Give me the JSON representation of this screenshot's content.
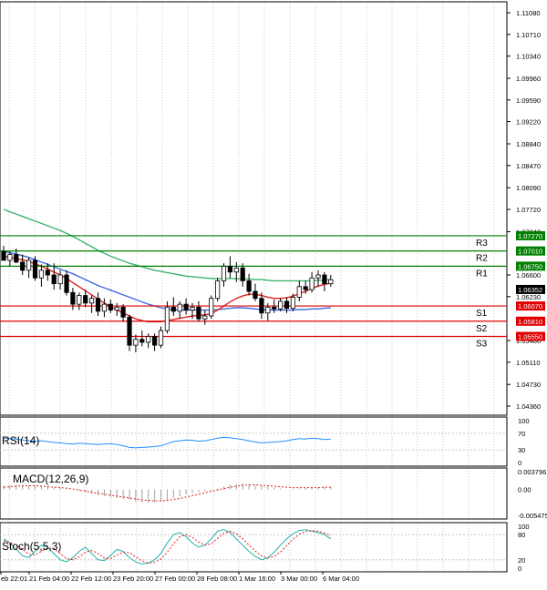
{
  "chart_data": {
    "type": "candlestick",
    "time_labels": [
      "eb 22:01",
      "21 Feb 04:00",
      "22 Feb 12:00",
      "23 Feb 20:00",
      "27 Feb 00:00",
      "28 Feb 08:00",
      "1 Mar 16:00",
      "3 Mar 00:00",
      "6 Mar 04:00"
    ],
    "price_ticks": [
      "1.11080",
      "1.10710",
      "1.10340",
      "1.09960",
      "1.09590",
      "1.09220",
      "1.08840",
      "1.08470",
      "1.08090",
      "1.07720",
      "1.07340",
      "1.06600",
      "1.06230",
      "1.05480",
      "1.05110",
      "1.04730",
      "1.04360"
    ],
    "current_price": "1.06352",
    "levels": [
      {
        "name": "R3",
        "value": "1.07270",
        "color": "#008000"
      },
      {
        "name": "R2",
        "value": "1.07010",
        "color": "#008000"
      },
      {
        "name": "R1",
        "value": "1.06750",
        "color": "#008000"
      },
      {
        "name": "S1",
        "value": "1.06070",
        "color": "#e00000"
      },
      {
        "name": "S2",
        "value": "1.05810",
        "color": "#e00000"
      },
      {
        "name": "S3",
        "value": "1.05550",
        "color": "#e00000"
      }
    ],
    "candles": [
      {
        "o": 1.07,
        "h": 1.071,
        "l": 1.069,
        "c": 1.0685
      },
      {
        "o": 1.0685,
        "h": 1.07,
        "l": 1.0675,
        "c": 1.0695
      },
      {
        "o": 1.0695,
        "h": 1.0705,
        "l": 1.068,
        "c": 1.0682
      },
      {
        "o": 1.0682,
        "h": 1.0695,
        "l": 1.066,
        "c": 1.0668
      },
      {
        "o": 1.0668,
        "h": 1.069,
        "l": 1.0655,
        "c": 1.0685
      },
      {
        "o": 1.0685,
        "h": 1.0692,
        "l": 1.065,
        "c": 1.0655
      },
      {
        "o": 1.0655,
        "h": 1.0678,
        "l": 1.064,
        "c": 1.0668
      },
      {
        "o": 1.0668,
        "h": 1.068,
        "l": 1.065,
        "c": 1.066
      },
      {
        "o": 1.066,
        "h": 1.068,
        "l": 1.0635,
        "c": 1.0645
      },
      {
        "o": 1.0645,
        "h": 1.0668,
        "l": 1.0635,
        "c": 1.066
      },
      {
        "o": 1.066,
        "h": 1.0668,
        "l": 1.0625,
        "c": 1.063
      },
      {
        "o": 1.063,
        "h": 1.0638,
        "l": 1.06,
        "c": 1.061
      },
      {
        "o": 1.061,
        "h": 1.063,
        "l": 1.06,
        "c": 1.0625
      },
      {
        "o": 1.0625,
        "h": 1.0635,
        "l": 1.0605,
        "c": 1.0612
      },
      {
        "o": 1.0612,
        "h": 1.0625,
        "l": 1.0595,
        "c": 1.062
      },
      {
        "o": 1.062,
        "h": 1.063,
        "l": 1.059,
        "c": 1.0598
      },
      {
        "o": 1.0598,
        "h": 1.062,
        "l": 1.0588,
        "c": 1.061
      },
      {
        "o": 1.061,
        "h": 1.0618,
        "l": 1.0595,
        "c": 1.06
      },
      {
        "o": 1.06,
        "h": 1.0612,
        "l": 1.059,
        "c": 1.0605
      },
      {
        "o": 1.0605,
        "h": 1.061,
        "l": 1.058,
        "c": 1.0588
      },
      {
        "o": 1.0588,
        "h": 1.0592,
        "l": 1.053,
        "c": 1.054
      },
      {
        "o": 1.054,
        "h": 1.0558,
        "l": 1.0528,
        "c": 1.055
      },
      {
        "o": 1.055,
        "h": 1.0565,
        "l": 1.0538,
        "c": 1.0545
      },
      {
        "o": 1.0545,
        "h": 1.056,
        "l": 1.0535,
        "c": 1.0555
      },
      {
        "o": 1.0555,
        "h": 1.056,
        "l": 1.053,
        "c": 1.054
      },
      {
        "o": 1.054,
        "h": 1.0572,
        "l": 1.0535,
        "c": 1.0565
      },
      {
        "o": 1.0565,
        "h": 1.0615,
        "l": 1.056,
        "c": 1.0605
      },
      {
        "o": 1.0605,
        "h": 1.0622,
        "l": 1.059,
        "c": 1.0598
      },
      {
        "o": 1.0598,
        "h": 1.0615,
        "l": 1.0585,
        "c": 1.061
      },
      {
        "o": 1.061,
        "h": 1.062,
        "l": 1.0592,
        "c": 1.06
      },
      {
        "o": 1.06,
        "h": 1.0612,
        "l": 1.0585,
        "c": 1.0605
      },
      {
        "o": 1.0605,
        "h": 1.0615,
        "l": 1.058,
        "c": 1.0585
      },
      {
        "o": 1.0585,
        "h": 1.06,
        "l": 1.0575,
        "c": 1.059
      },
      {
        "o": 1.059,
        "h": 1.0625,
        "l": 1.0585,
        "c": 1.062
      },
      {
        "o": 1.062,
        "h": 1.0655,
        "l": 1.0615,
        "c": 1.065
      },
      {
        "o": 1.065,
        "h": 1.068,
        "l": 1.064,
        "c": 1.0675
      },
      {
        "o": 1.0675,
        "h": 1.0692,
        "l": 1.0655,
        "c": 1.0665
      },
      {
        "o": 1.0665,
        "h": 1.0682,
        "l": 1.0648,
        "c": 1.0672
      },
      {
        "o": 1.0672,
        "h": 1.068,
        "l": 1.064,
        "c": 1.065
      },
      {
        "o": 1.065,
        "h": 1.0662,
        "l": 1.0625,
        "c": 1.0632
      },
      {
        "o": 1.0632,
        "h": 1.0645,
        "l": 1.0615,
        "c": 1.062
      },
      {
        "o": 1.062,
        "h": 1.063,
        "l": 1.0585,
        "c": 1.0595
      },
      {
        "o": 1.0595,
        "h": 1.0612,
        "l": 1.0582,
        "c": 1.0605
      },
      {
        "o": 1.0605,
        "h": 1.0618,
        "l": 1.0595,
        "c": 1.0602
      },
      {
        "o": 1.0602,
        "h": 1.062,
        "l": 1.0598,
        "c": 1.0615
      },
      {
        "o": 1.0615,
        "h": 1.0622,
        "l": 1.0595,
        "c": 1.0603
      },
      {
        "o": 1.0603,
        "h": 1.0628,
        "l": 1.0598,
        "c": 1.0622
      },
      {
        "o": 1.0622,
        "h": 1.065,
        "l": 1.0615,
        "c": 1.064
      },
      {
        "o": 1.064,
        "h": 1.065,
        "l": 1.0628,
        "c": 1.0635
      },
      {
        "o": 1.0635,
        "h": 1.0665,
        "l": 1.063,
        "c": 1.0655
      },
      {
        "o": 1.0655,
        "h": 1.0668,
        "l": 1.064,
        "c": 1.066
      },
      {
        "o": 1.066,
        "h": 1.0665,
        "l": 1.0632,
        "c": 1.0645
      },
      {
        "o": 1.0645,
        "h": 1.066,
        "l": 1.064,
        "c": 1.0652
      }
    ],
    "ma_green": [
      1.0772,
      1.0768,
      1.0764,
      1.076,
      1.0756,
      1.0752,
      1.0748,
      1.0744,
      1.074,
      1.0736,
      1.0731,
      1.0726,
      1.072,
      1.0714,
      1.0708,
      1.0702,
      1.0697,
      1.0692,
      1.0688,
      1.0684,
      1.068,
      1.0677,
      1.0674,
      1.0671,
      1.0668,
      1.0666,
      1.0664,
      1.0662,
      1.066,
      1.0658,
      1.0657,
      1.0656,
      1.0655,
      1.0654,
      1.0654,
      1.0654,
      1.0654,
      1.0654,
      1.0653,
      1.0653,
      1.0652,
      1.0652,
      1.0651,
      1.065,
      1.065,
      1.065,
      1.065,
      1.065,
      1.065,
      1.065,
      1.0651,
      1.0651,
      1.0652
    ],
    "ma_blue": [
      1.07,
      1.0698,
      1.0696,
      1.0693,
      1.069,
      1.0686,
      1.0682,
      1.0678,
      1.0674,
      1.067,
      1.0666,
      1.0662,
      1.0657,
      1.0652,
      1.0647,
      1.0642,
      1.0638,
      1.0634,
      1.063,
      1.0626,
      1.0622,
      1.0618,
      1.0614,
      1.061,
      1.0607,
      1.0604,
      1.0602,
      1.0601,
      1.06,
      1.06,
      1.06,
      1.06,
      1.06,
      1.06,
      1.0601,
      1.0602,
      1.0603,
      1.0604,
      1.0604,
      1.0603,
      1.0602,
      1.0601,
      1.06,
      1.06,
      1.06,
      1.06,
      1.06,
      1.0601,
      1.0601,
      1.0602,
      1.0602,
      1.0603,
      1.0604
    ],
    "ma_red": [
      1.0692,
      1.069,
      1.0688,
      1.0686,
      1.0683,
      1.0679,
      1.0675,
      1.067,
      1.0665,
      1.066,
      1.0654,
      1.0647,
      1.064,
      1.0633,
      1.0626,
      1.0619,
      1.0612,
      1.0606,
      1.06,
      1.0595,
      1.059,
      1.0585,
      1.0582,
      1.058,
      1.058,
      1.058,
      1.0582,
      1.0584,
      1.0586,
      1.0588,
      1.059,
      1.0591,
      1.0592,
      1.0594,
      1.06,
      1.0607,
      1.0614,
      1.062,
      1.0624,
      1.0627,
      1.0627,
      1.0625,
      1.0622,
      1.062,
      1.062,
      1.0621,
      1.0624,
      1.0628,
      1.0632,
      1.0637,
      1.0641,
      1.0644,
      1.0646
    ],
    "rsi": {
      "label": "RSI(14)",
      "scale": [
        "100",
        "70",
        "30",
        "0"
      ],
      "values": [
        58,
        57,
        56,
        54,
        52,
        51,
        52,
        50,
        48,
        47,
        45,
        44,
        46,
        45,
        44,
        43,
        44,
        45,
        43,
        40,
        36,
        35,
        36,
        37,
        38,
        40,
        45,
        50,
        52,
        54,
        53,
        51,
        52,
        55,
        58,
        60,
        59,
        57,
        55,
        52,
        49,
        47,
        48,
        49,
        50,
        52,
        55,
        57,
        56,
        58,
        57,
        55,
        56
      ]
    },
    "macd": {
      "label": "MACD(12,26,9)",
      "scale": [
        "0.003796",
        "0.00",
        "-0.005475"
      ],
      "hist": [
        0.0008,
        0.0009,
        0.001,
        0.001,
        0.0009,
        0.0008,
        0.0007,
        0.0006,
        0.0005,
        0.0004,
        0.0002,
        0.0,
        -0.0003,
        -0.0006,
        -0.0009,
        -0.0012,
        -0.0014,
        -0.0016,
        -0.0018,
        -0.002,
        -0.0023,
        -0.0026,
        -0.0027,
        -0.0028,
        -0.0027,
        -0.0025,
        -0.0022,
        -0.0018,
        -0.0014,
        -0.001,
        -0.0008,
        -0.0006,
        -0.0004,
        -0.0002,
        0.0002,
        0.0006,
        0.001,
        0.0012,
        0.0013,
        0.0012,
        0.001,
        0.0008,
        0.0006,
        0.0004,
        0.0002,
        0.0001,
        0.0001,
        0.0002,
        0.0003,
        0.0004,
        0.0005,
        0.0005,
        0.0006
      ],
      "signal": [
        0.0005,
        0.0006,
        0.0007,
        0.0008,
        0.0008,
        0.0008,
        0.0007,
        0.0006,
        0.0005,
        0.0004,
        0.0003,
        0.0001,
        -0.0001,
        -0.0003,
        -0.0006,
        -0.0008,
        -0.001,
        -0.0012,
        -0.0014,
        -0.0016,
        -0.0018,
        -0.002,
        -0.0022,
        -0.0023,
        -0.0024,
        -0.0024,
        -0.0023,
        -0.0021,
        -0.0019,
        -0.0016,
        -0.0013,
        -0.001,
        -0.0007,
        -0.0004,
        -0.0001,
        0.0002,
        0.0005,
        0.0007,
        0.0009,
        0.001,
        0.001,
        0.0009,
        0.0008,
        0.0007,
        0.0006,
        0.0005,
        0.0004,
        0.0004,
        0.0004,
        0.0004,
        0.0004,
        0.0005,
        0.0005
      ]
    },
    "stoch": {
      "label": "Stoch(5,5,3)",
      "scale": [
        "100",
        "80",
        "20",
        "0"
      ],
      "k": [
        70,
        60,
        45,
        30,
        25,
        40,
        55,
        50,
        35,
        20,
        15,
        25,
        40,
        50,
        35,
        20,
        18,
        30,
        45,
        40,
        25,
        15,
        10,
        12,
        20,
        35,
        60,
        80,
        85,
        75,
        60,
        50,
        55,
        70,
        88,
        92,
        85,
        70,
        55,
        40,
        28,
        20,
        25,
        38,
        55,
        70,
        82,
        90,
        92,
        88,
        85,
        80,
        70
      ],
      "d": [
        65,
        62,
        55,
        45,
        33,
        32,
        40,
        48,
        47,
        35,
        23,
        20,
        27,
        38,
        42,
        35,
        24,
        23,
        31,
        38,
        37,
        27,
        17,
        12,
        14,
        22,
        38,
        58,
        75,
        80,
        73,
        62,
        55,
        58,
        71,
        83,
        88,
        82,
        70,
        55,
        41,
        29,
        24,
        28,
        39,
        54,
        69,
        81,
        88,
        90,
        88,
        84,
        78
      ]
    }
  }
}
